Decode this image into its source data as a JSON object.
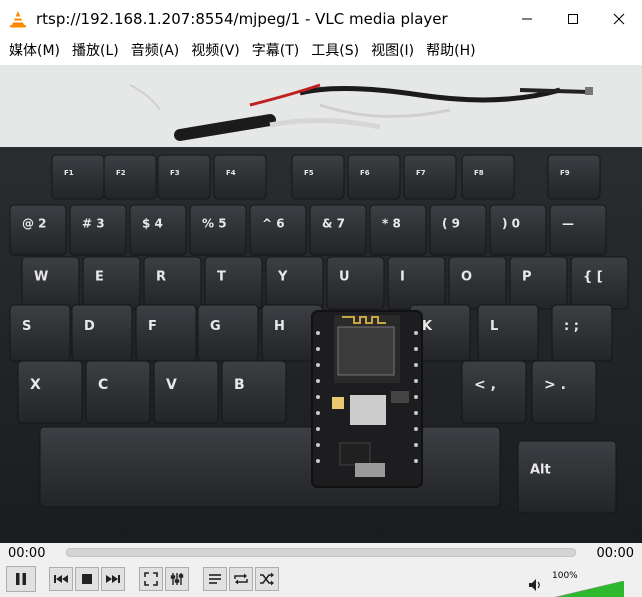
{
  "window": {
    "title": "rtsp://192.168.1.207:8554/mjpeg/1 - VLC media player",
    "app_icon": "vlc-cone-icon",
    "controls": [
      "minimize-icon",
      "maximize-icon",
      "close-icon"
    ]
  },
  "menu": {
    "items": [
      {
        "label": "媒体(M)"
      },
      {
        "label": "播放(L)"
      },
      {
        "label": "音频(A)"
      },
      {
        "label": "视频(V)"
      },
      {
        "label": "字幕(T)"
      },
      {
        "label": "工具(S)"
      },
      {
        "label": "视图(I)"
      },
      {
        "label": "帮助(H)"
      }
    ]
  },
  "video": {
    "description_content": "webcam view of a keyboard with an ESP8266 NodeMCU board",
    "keys_row1": [
      "F1",
      "F2",
      "F3",
      "F4",
      "F5",
      "F6",
      "F7",
      "F8",
      "F9"
    ],
    "keys_row2": [
      "@ 2",
      "# 3",
      "$ 4",
      "% 5",
      "^ 6",
      "& 7",
      "* 8",
      "( 9",
      ") 0",
      "—"
    ],
    "keys_row3": [
      "W",
      "E",
      "R",
      "T",
      "Y",
      "U",
      "I",
      "O",
      "P",
      "{ ["
    ],
    "keys_row4": [
      "S",
      "D",
      "F",
      "G",
      "H",
      "K",
      "L",
      ": ;"
    ],
    "keys_row5": [
      "X",
      "C",
      "V",
      "B",
      "< ,",
      "> ."
    ],
    "alt_key": "Alt"
  },
  "playback": {
    "elapsed": "00:00",
    "remaining": "00:00",
    "position_fraction": 0.0
  },
  "buttons": {
    "pause": "pause-icon",
    "previous": "previous-icon",
    "stop": "stop-icon",
    "next": "next-icon",
    "fullscreen": "fullscreen-icon",
    "extended": "extended-settings-icon",
    "playlist": "playlist-icon",
    "loop": "loop-icon",
    "shuffle": "shuffle-icon"
  },
  "volume": {
    "percent_label": "100%",
    "level_fraction": 1.0,
    "accent": "#2db82d"
  }
}
